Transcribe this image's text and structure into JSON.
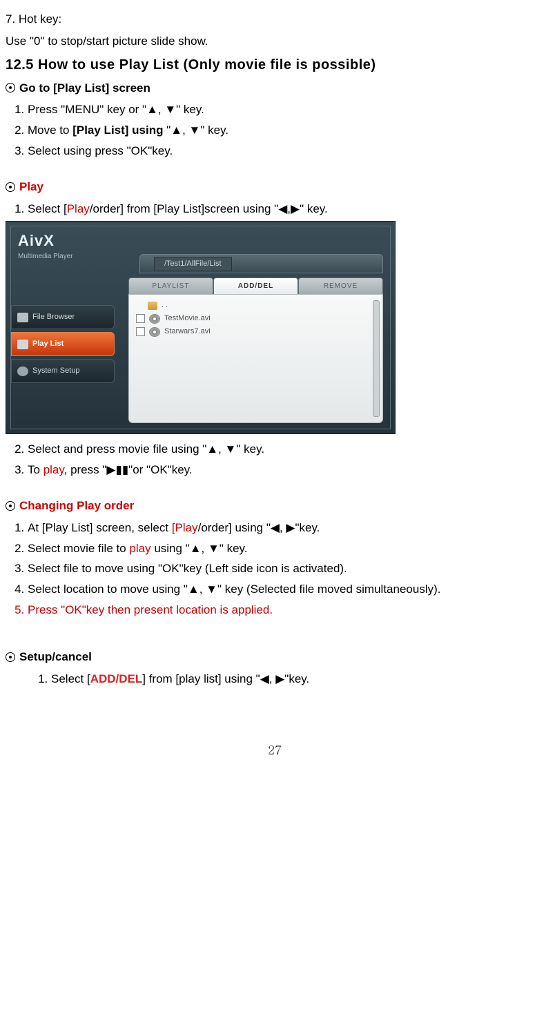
{
  "hotkey": {
    "title": "7. Hot key:",
    "desc": "Use \"0\" to stop/start picture slide show."
  },
  "section": {
    "title": "12.5  How to use Play List (Only movie file is possible)"
  },
  "goto": {
    "title": "Go to [Play List] screen",
    "steps": [
      "Press \"MENU\" key or \"▲, ▼\" key.",
      "Move to [Play List] using \"▲, ▼\" key.",
      "Select using press \"OK\"key."
    ],
    "step2_pre": "Move to ",
    "step2_bold": "[Play List] using",
    "step2_post": " \"▲, ▼\" key."
  },
  "play": {
    "title": "Play",
    "step1_pre": "Select [",
    "step1_red": "Play",
    "step1_post": "/order] from [Play List]screen using \"◀,▶\"   key.",
    "step2": "Select and press movie file using \"▲, ▼\" key.",
    "step3_pre": "To ",
    "step3_red": "play",
    "step3_post": ", press \"▶▮▮\"or \"OK\"key."
  },
  "change": {
    "title": "Changing Play order",
    "s1_pre": "At [Play List] screen, select ",
    "s1_red": "[Play",
    "s1_post": "/order] using \"◀, ▶\"key.",
    "s2_pre": "Select movie file to ",
    "s2_red": "play",
    "s2_post": " using \"▲, ▼\" key.",
    "s3": "Select file to move using \"OK\"key (Left side icon is activated).",
    "s4": "Select location to move using \"▲, ▼\" key (Selected file moved simultaneously).",
    "s5": "Press \"OK\"key then present location is applied."
  },
  "setup": {
    "title": "Setup/cancel",
    "s1_pre": "Select [",
    "s1_red": "ADD/DEL",
    "s1_post": "] from [play list] using \"◀, ▶\"key."
  },
  "screenshot": {
    "brand": "AivX",
    "brand_sub": "Multimedia Player",
    "breadcrumb": "/Test1/AllFile/List",
    "sidebar": [
      "File Browser",
      "Play List",
      "System Setup"
    ],
    "tabs": [
      "PLAYLIST",
      "ADD/DEL",
      "REMOVE"
    ],
    "files": [
      {
        "icon": "folder",
        "name": ". ."
      },
      {
        "icon": "disc",
        "name": "TestMovie.avi"
      },
      {
        "icon": "disc",
        "name": "Starwars7.avi"
      }
    ]
  },
  "page_number": "27"
}
